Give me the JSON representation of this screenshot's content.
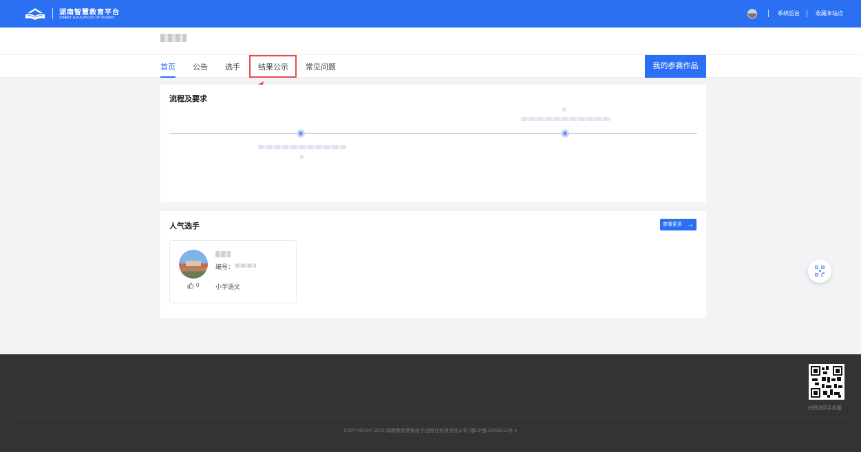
{
  "header": {
    "brand_cn": "湖南智慧教育平台",
    "brand_en": "SMART EDUCATION OF HUNAN",
    "links": [
      "系统后台",
      "收藏本站点"
    ],
    "accent": "#2b6ff2"
  },
  "nav": {
    "tabs": [
      "首页",
      "公告",
      "选手",
      "结果公示",
      "常见问题"
    ],
    "active": "首页",
    "my_works_button": "我的参赛作品",
    "highlight_color": "#e84a4a"
  },
  "process": {
    "title": "流程及要求"
  },
  "popular": {
    "title": "人气选手",
    "more_button": "查看更多",
    "more_icon": "arrow-right-icon",
    "player": {
      "id_label": "编号：",
      "likes": "0",
      "subject": "小学语文"
    }
  },
  "footer": {
    "qr_label": "扫码访问手机版",
    "copyright": "COPYRIGHT 2023 湖南教育音像电子出版社有限责任公司 湘ICP备12008311号-4"
  }
}
